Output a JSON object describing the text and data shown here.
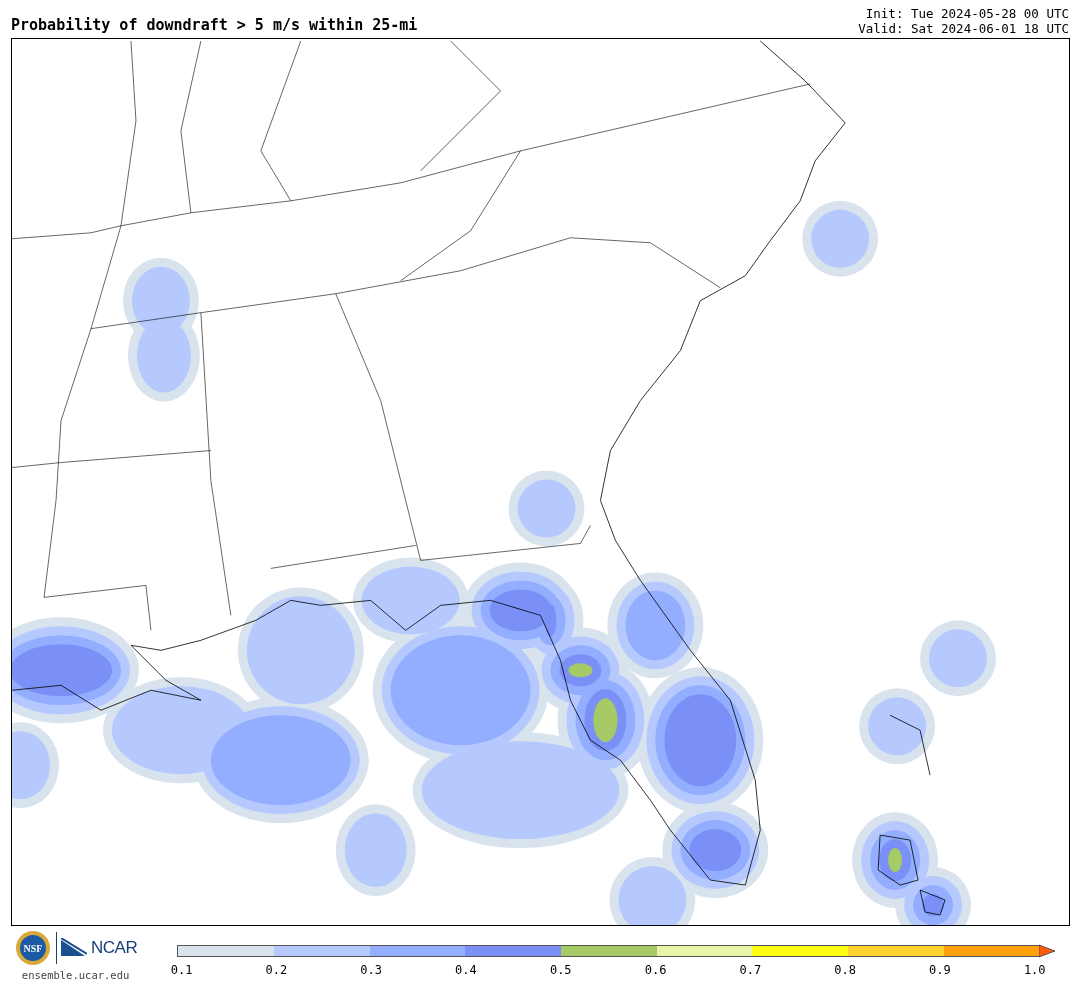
{
  "title": "Probability of downdraft > 5 m/s within 25-mi",
  "init": "Init: Tue 2024-05-28 00 UTC",
  "valid": "Valid: Sat 2024-06-01 18 UTC",
  "logos": {
    "nsf": "NSF",
    "ncar": "NCAR",
    "url": "ensemble.ucar.edu"
  },
  "colorbar": {
    "segments": [
      {
        "color": "#d8e3ee"
      },
      {
        "color": "#b5c9ff"
      },
      {
        "color": "#93aeff"
      },
      {
        "color": "#7a90f6"
      },
      {
        "color": "#a5ca66"
      },
      {
        "color": "#e8f5a8"
      },
      {
        "color": "#ffff14"
      },
      {
        "color": "#ffd42e"
      },
      {
        "color": "#ff9f0a"
      }
    ],
    "extend_arrow": {
      "color": "#ff5a0a"
    },
    "ticks": [
      "0.1",
      "0.2",
      "0.3",
      "0.4",
      "0.5",
      "0.6",
      "0.7",
      "0.8",
      "0.9",
      "1.0"
    ]
  }
}
